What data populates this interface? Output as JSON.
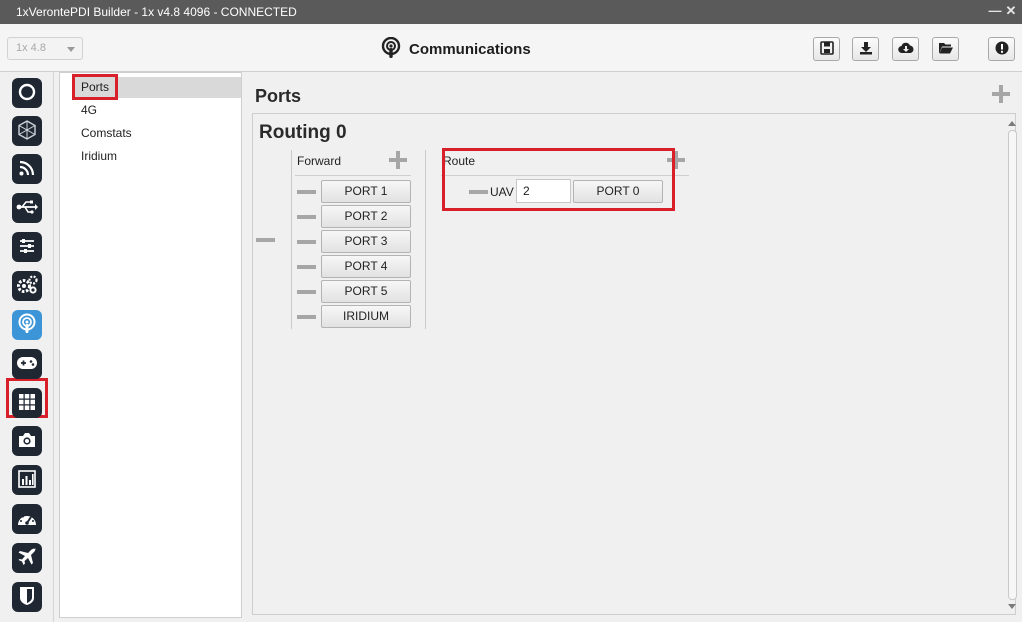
{
  "window": {
    "title": "1xVerontePDI Builder - 1x v4.8 4096 - CONNECTED",
    "controls": [
      "minimize-icon",
      "close-icon"
    ]
  },
  "toolbar": {
    "version_value": "1x 4.8",
    "page_title": "Communications",
    "page_icon": "podcast-icon",
    "buttons": [
      "save-icon",
      "download-icon",
      "cloud-download-icon",
      "folder-open-icon",
      "alert-icon"
    ]
  },
  "sidebar": {
    "items": [
      {
        "icon": "power-ring-icon"
      },
      {
        "icon": "hexagon-grid-icon"
      },
      {
        "icon": "rss-icon"
      },
      {
        "icon": "usb-icon"
      },
      {
        "icon": "sliders-icon"
      },
      {
        "icon": "gears-icon"
      },
      {
        "icon": "podcast-icon",
        "active": true
      },
      {
        "icon": "gamepad-icon"
      },
      {
        "icon": "grid-icon"
      },
      {
        "icon": "camera-icon"
      },
      {
        "icon": "bar-chart-icon"
      },
      {
        "icon": "dashboard-icon"
      },
      {
        "icon": "plane-icon"
      },
      {
        "icon": "shield-icon"
      }
    ],
    "active_color": "#3b95d6",
    "dark_color": "#1f2733"
  },
  "nav": {
    "items": [
      {
        "label": "Ports",
        "selected": true
      },
      {
        "label": "4G"
      },
      {
        "label": "Comstats"
      },
      {
        "label": "Iridium"
      }
    ]
  },
  "content": {
    "title": "Ports",
    "routing": {
      "title": "Routing 0",
      "forward": {
        "label": "Forward",
        "ports": [
          "PORT 1",
          "PORT 2",
          "PORT 3",
          "PORT 4",
          "PORT 5",
          "IRIDIUM"
        ]
      },
      "route": {
        "label": "Route",
        "uav_label": "UAV",
        "uav_value": "2",
        "port": "PORT 0"
      }
    }
  },
  "highlight_color": "#d8202a"
}
